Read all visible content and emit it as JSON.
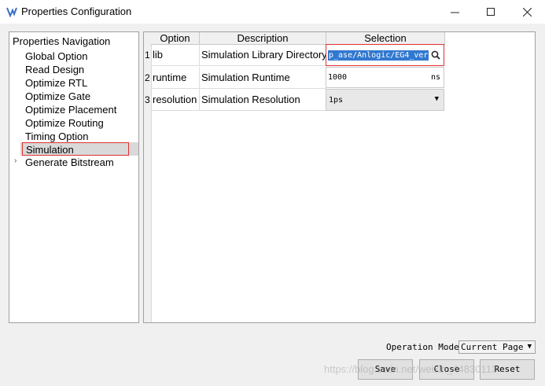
{
  "window": {
    "title": "Properties Configuration",
    "minimize_glyph": "—",
    "maximize_glyph": "☐",
    "close_glyph": "✕"
  },
  "nav": {
    "title": "Properties Navigation",
    "items": [
      {
        "label": "Global Option"
      },
      {
        "label": "Read Design"
      },
      {
        "label": "Optimize RTL"
      },
      {
        "label": "Optimize Gate"
      },
      {
        "label": "Optimize Placement"
      },
      {
        "label": "Optimize Routing"
      },
      {
        "label": "Timing Option"
      },
      {
        "label": "Simulation",
        "selected": true
      },
      {
        "label": "Generate Bitstream",
        "expandable": true
      }
    ],
    "expand_glyph": "›"
  },
  "table": {
    "headers": [
      "Option",
      "Description",
      "Selection"
    ],
    "rows": [
      {
        "num": "1",
        "option": "lib",
        "description": "Simulation Library Directory",
        "selection": "p_ase/Anlogic/EG4_ver"
      },
      {
        "num": "2",
        "option": "runtime",
        "description": "Simulation Runtime",
        "selection": "1000",
        "unit": "ns"
      },
      {
        "num": "3",
        "option": "resolution",
        "description": "Simulation Resolution",
        "selection": "1ps"
      }
    ]
  },
  "footer": {
    "operation_mode_label": "Operation Mode",
    "operation_mode_value": "Current Page",
    "save": "Save",
    "close": "Close",
    "reset": "Reset",
    "watermark": "https://blog.csdn.net/weixin_44830113"
  },
  "colors": {
    "accent_selection": "#3078d0",
    "highlight_border": "#e03030"
  }
}
